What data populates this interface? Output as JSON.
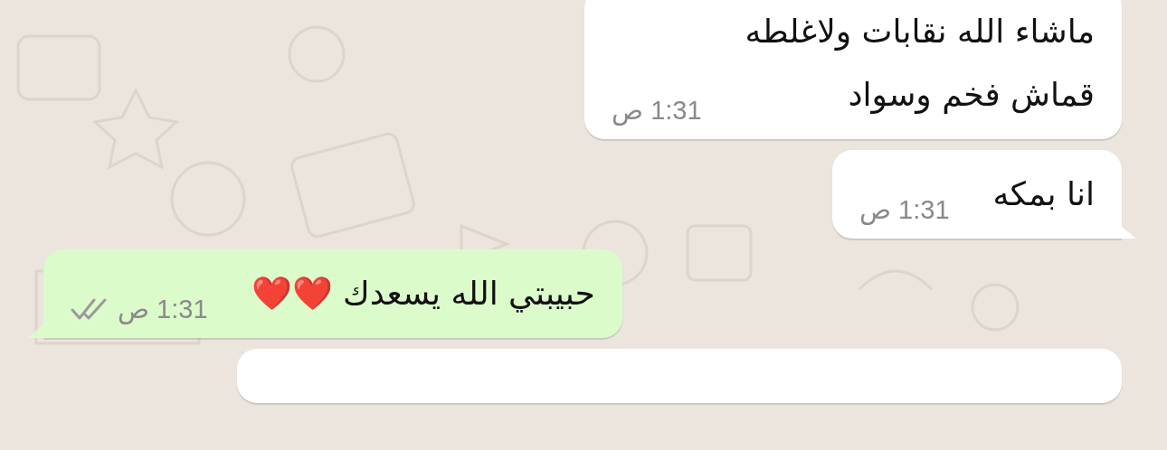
{
  "messages": [
    {
      "kind": "incoming",
      "lines": [
        "ماشاء الله نقابات ولاغلطه",
        "قماش فخم وسواد"
      ],
      "time": "1:31 ص",
      "tail": false
    },
    {
      "kind": "incoming",
      "lines": [
        "انا بمكه"
      ],
      "time": "1:31 ص",
      "tail": true
    },
    {
      "kind": "outgoing",
      "lines": [
        "حبيبتي الله يسعدك"
      ],
      "emoji": "❤️❤️",
      "time": "1:31 ص",
      "read": false,
      "tail": true
    },
    {
      "kind": "incoming",
      "tail": false
    }
  ]
}
